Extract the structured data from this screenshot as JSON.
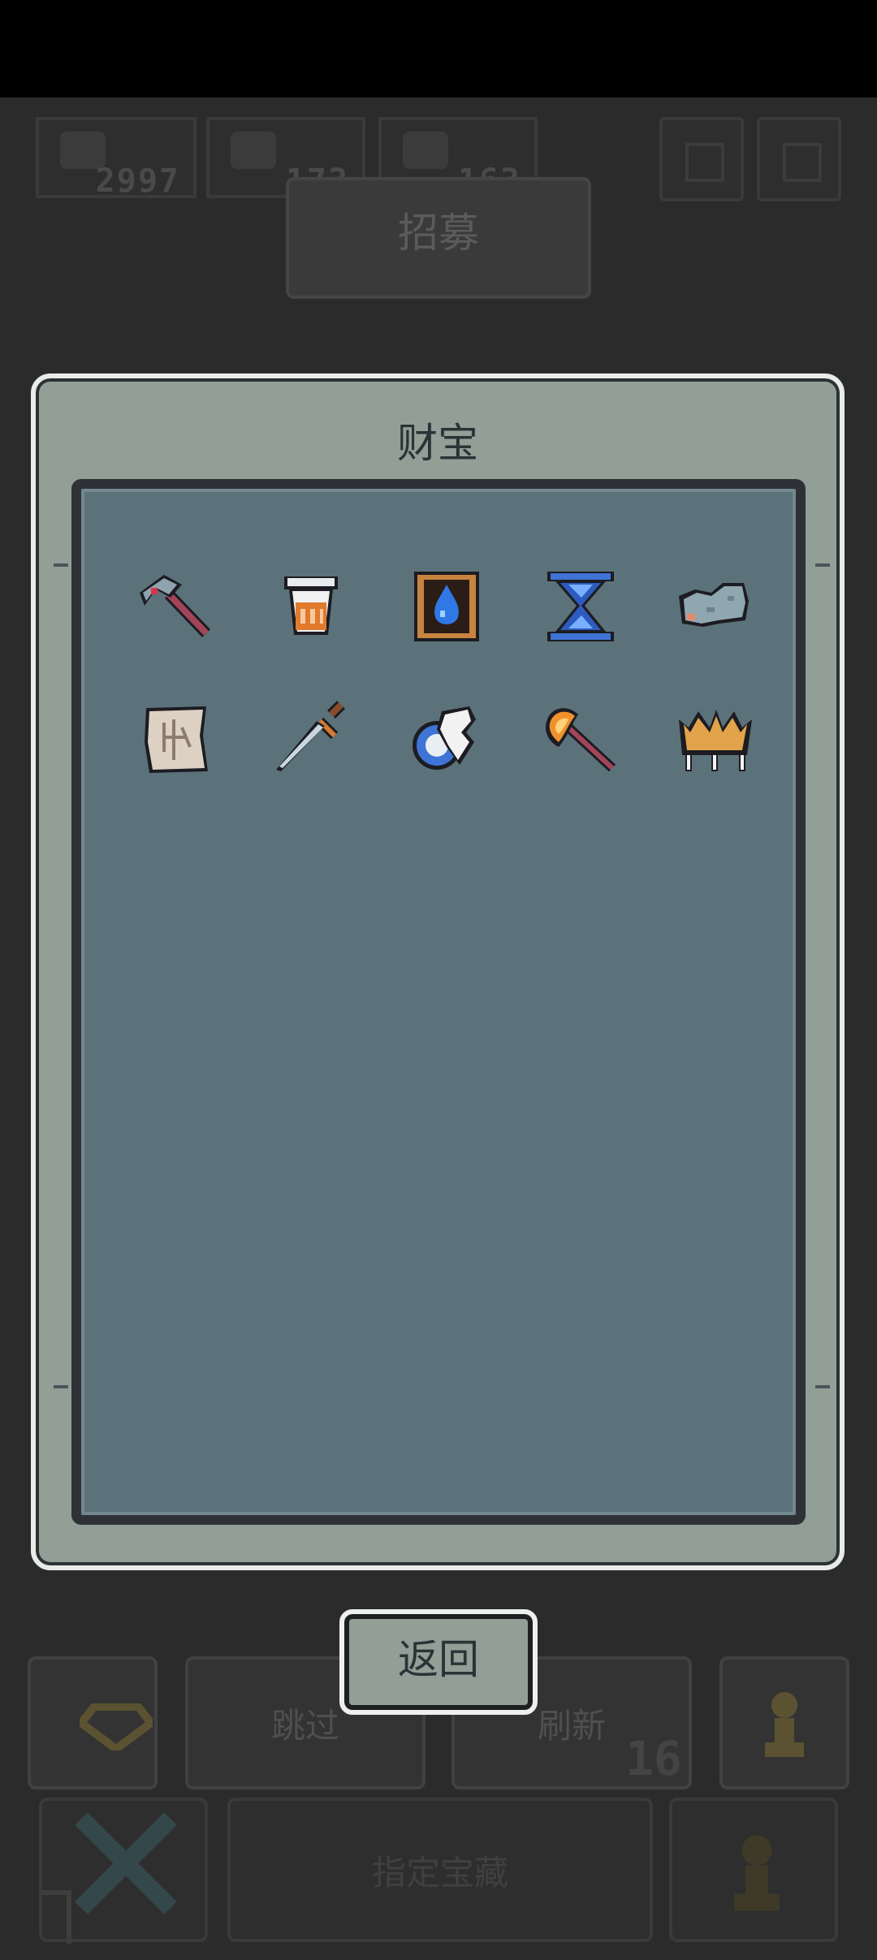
{
  "hud": {
    "resources": [
      {
        "name": "coin-icon",
        "value": "2997"
      },
      {
        "name": "swirl-icon",
        "value": "173"
      },
      {
        "name": "swirl-icon",
        "value": "163"
      }
    ]
  },
  "background": {
    "recruit_tab": "招募",
    "skip_label": "跳过",
    "refresh_label": "刷新",
    "refresh_count": "16",
    "bottom_label": "指定宝藏"
  },
  "modal": {
    "title": "财宝",
    "items": [
      {
        "icon": "hammer-icon"
      },
      {
        "icon": "bucket-icon"
      },
      {
        "icon": "water-drop-tome-icon"
      },
      {
        "icon": "hourglass-icon"
      },
      {
        "icon": "stone-rock-icon"
      },
      {
        "icon": "map-scroll-icon"
      },
      {
        "icon": "dagger-icon"
      },
      {
        "icon": "wing-orb-icon"
      },
      {
        "icon": "fire-axe-icon"
      },
      {
        "icon": "crown-claw-icon"
      }
    ]
  },
  "back_button": {
    "label": "返回"
  },
  "colors": {
    "modal_frame": "#929f97",
    "modal_panel": "#5c727a",
    "outline": "#2e3236"
  }
}
